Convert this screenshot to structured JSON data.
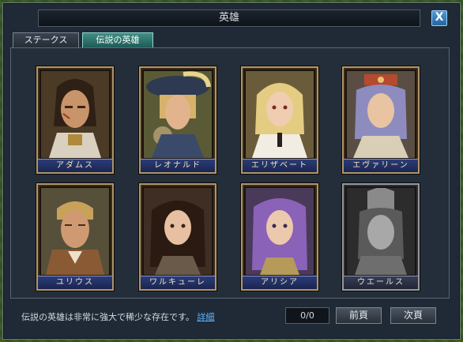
{
  "window": {
    "title": "英雄",
    "close_label": "X"
  },
  "tabs": [
    {
      "label": "ステークス",
      "active": false
    },
    {
      "label": "伝説の英雄",
      "active": true
    }
  ],
  "heroes": [
    {
      "name": "アダムス",
      "grayscale": false
    },
    {
      "name": "レオナルド",
      "grayscale": false
    },
    {
      "name": "エリザベート",
      "grayscale": false
    },
    {
      "name": "エヴァリーン",
      "grayscale": false
    },
    {
      "name": "ユリウス",
      "grayscale": false
    },
    {
      "name": "ワルキューレ",
      "grayscale": false
    },
    {
      "name": "アリシア",
      "grayscale": false
    },
    {
      "name": "ウエールス",
      "grayscale": true
    }
  ],
  "footer": {
    "description": "伝説の英雄は非常に強大で稀少な存在です。",
    "details_link": "詳細",
    "counter": "0/0",
    "prev_label": "前頁",
    "next_label": "次頁"
  },
  "colors": {
    "accent_tab": "#2f7a72",
    "nameplate": "#22306a",
    "link": "#5eb2ff"
  }
}
